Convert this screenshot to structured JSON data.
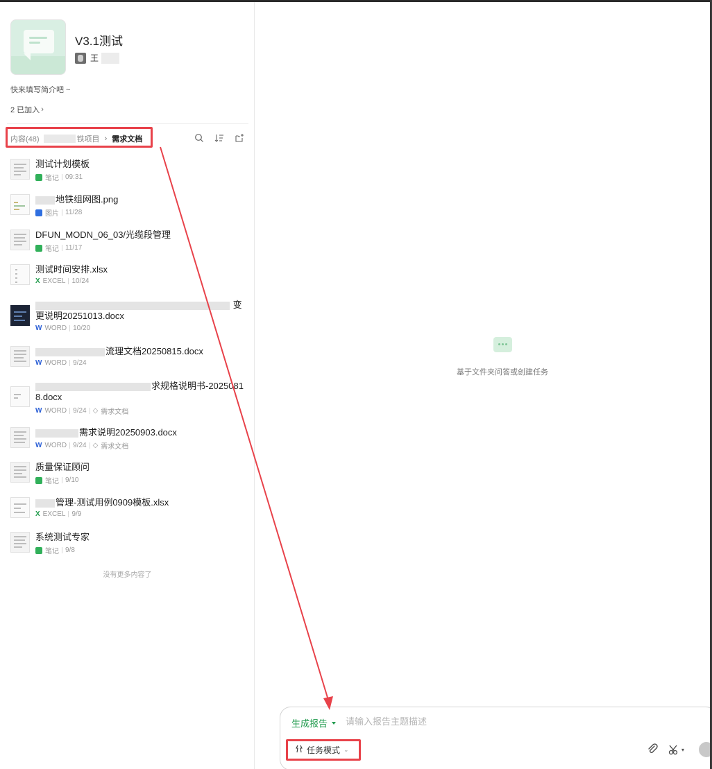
{
  "knowledge_base": {
    "title": "V3.1测试",
    "owner_name": "王",
    "intro": "快来填写简介吧 ~",
    "members": "2 已加入"
  },
  "breadcrumb": {
    "root": "内容(48)",
    "parent": "铁项目",
    "current": "需求文档"
  },
  "icons": {
    "search": "search-icon",
    "sort": "sort-icon",
    "new": "new-folder-icon"
  },
  "files": [
    {
      "name": "测试计划模板",
      "type": "笔记",
      "date": "09:31",
      "kind": "note"
    },
    {
      "name": "地铁组网图.png",
      "type": "图片",
      "date": "11/28",
      "kind": "image"
    },
    {
      "name": "DFUN_MODN_06_03/光缆段管理",
      "type": "笔记",
      "date": "11/17",
      "kind": "note"
    },
    {
      "name": "测试时间安排.xlsx",
      "type": "EXCEL",
      "date": "10/24",
      "kind": "excel"
    },
    {
      "name_line1": "变",
      "name_line2": "更说明20251013.docx",
      "type": "WORD",
      "date": "10/20",
      "kind": "word"
    },
    {
      "name": "流理文档20250815.docx",
      "type": "WORD",
      "date": "9/24",
      "kind": "word"
    },
    {
      "name_line1": "求规格说明书-2025081",
      "name_line2": "8.docx",
      "type": "WORD",
      "date": "9/24",
      "tag": "需求文档",
      "kind": "word"
    },
    {
      "name": "需求说明20250903.docx",
      "type": "WORD",
      "date": "9/24",
      "tag": "需求文档",
      "kind": "word"
    },
    {
      "name": "质量保证顾问",
      "type": "笔记",
      "date": "9/10",
      "kind": "note"
    },
    {
      "name": "管理-测试用例0909模板.xlsx",
      "type": "EXCEL",
      "date": "9/9",
      "kind": "excel"
    },
    {
      "name": "系统测试专家",
      "type": "笔记",
      "date": "9/8",
      "kind": "note"
    }
  ],
  "no_more": "没有更多内容了",
  "empty_state": "基于文件夹问答或创建任务",
  "composer": {
    "mode": "生成报告",
    "placeholder": "请输入报告主题描述",
    "task_mode": "任务模式"
  },
  "colors": {
    "accent_green": "#1f9a4c",
    "annotation_red": "#e8424a"
  }
}
